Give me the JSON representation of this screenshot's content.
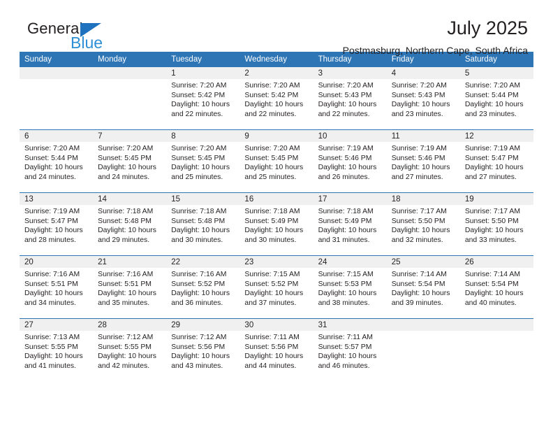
{
  "brand": {
    "name_dark": "General",
    "name_blue": "Blue",
    "accent_blue": "#2e75b6",
    "logo_blue": "#2d8fd5"
  },
  "header": {
    "title": "July 2025",
    "subtitle": "Postmasburg, Northern Cape, South Africa"
  },
  "calendar": {
    "weekday_headers": [
      "Sunday",
      "Monday",
      "Tuesday",
      "Wednesday",
      "Thursday",
      "Friday",
      "Saturday"
    ],
    "weeks": [
      [
        {
          "day": "",
          "sunrise": "",
          "sunset": "",
          "daylight": ""
        },
        {
          "day": "",
          "sunrise": "",
          "sunset": "",
          "daylight": ""
        },
        {
          "day": "1",
          "sunrise": "Sunrise: 7:20 AM",
          "sunset": "Sunset: 5:42 PM",
          "daylight": "Daylight: 10 hours and 22 minutes."
        },
        {
          "day": "2",
          "sunrise": "Sunrise: 7:20 AM",
          "sunset": "Sunset: 5:42 PM",
          "daylight": "Daylight: 10 hours and 22 minutes."
        },
        {
          "day": "3",
          "sunrise": "Sunrise: 7:20 AM",
          "sunset": "Sunset: 5:43 PM",
          "daylight": "Daylight: 10 hours and 22 minutes."
        },
        {
          "day": "4",
          "sunrise": "Sunrise: 7:20 AM",
          "sunset": "Sunset: 5:43 PM",
          "daylight": "Daylight: 10 hours and 23 minutes."
        },
        {
          "day": "5",
          "sunrise": "Sunrise: 7:20 AM",
          "sunset": "Sunset: 5:44 PM",
          "daylight": "Daylight: 10 hours and 23 minutes."
        }
      ],
      [
        {
          "day": "6",
          "sunrise": "Sunrise: 7:20 AM",
          "sunset": "Sunset: 5:44 PM",
          "daylight": "Daylight: 10 hours and 24 minutes."
        },
        {
          "day": "7",
          "sunrise": "Sunrise: 7:20 AM",
          "sunset": "Sunset: 5:45 PM",
          "daylight": "Daylight: 10 hours and 24 minutes."
        },
        {
          "day": "8",
          "sunrise": "Sunrise: 7:20 AM",
          "sunset": "Sunset: 5:45 PM",
          "daylight": "Daylight: 10 hours and 25 minutes."
        },
        {
          "day": "9",
          "sunrise": "Sunrise: 7:20 AM",
          "sunset": "Sunset: 5:45 PM",
          "daylight": "Daylight: 10 hours and 25 minutes."
        },
        {
          "day": "10",
          "sunrise": "Sunrise: 7:19 AM",
          "sunset": "Sunset: 5:46 PM",
          "daylight": "Daylight: 10 hours and 26 minutes."
        },
        {
          "day": "11",
          "sunrise": "Sunrise: 7:19 AM",
          "sunset": "Sunset: 5:46 PM",
          "daylight": "Daylight: 10 hours and 27 minutes."
        },
        {
          "day": "12",
          "sunrise": "Sunrise: 7:19 AM",
          "sunset": "Sunset: 5:47 PM",
          "daylight": "Daylight: 10 hours and 27 minutes."
        }
      ],
      [
        {
          "day": "13",
          "sunrise": "Sunrise: 7:19 AM",
          "sunset": "Sunset: 5:47 PM",
          "daylight": "Daylight: 10 hours and 28 minutes."
        },
        {
          "day": "14",
          "sunrise": "Sunrise: 7:18 AM",
          "sunset": "Sunset: 5:48 PM",
          "daylight": "Daylight: 10 hours and 29 minutes."
        },
        {
          "day": "15",
          "sunrise": "Sunrise: 7:18 AM",
          "sunset": "Sunset: 5:48 PM",
          "daylight": "Daylight: 10 hours and 30 minutes."
        },
        {
          "day": "16",
          "sunrise": "Sunrise: 7:18 AM",
          "sunset": "Sunset: 5:49 PM",
          "daylight": "Daylight: 10 hours and 30 minutes."
        },
        {
          "day": "17",
          "sunrise": "Sunrise: 7:18 AM",
          "sunset": "Sunset: 5:49 PM",
          "daylight": "Daylight: 10 hours and 31 minutes."
        },
        {
          "day": "18",
          "sunrise": "Sunrise: 7:17 AM",
          "sunset": "Sunset: 5:50 PM",
          "daylight": "Daylight: 10 hours and 32 minutes."
        },
        {
          "day": "19",
          "sunrise": "Sunrise: 7:17 AM",
          "sunset": "Sunset: 5:50 PM",
          "daylight": "Daylight: 10 hours and 33 minutes."
        }
      ],
      [
        {
          "day": "20",
          "sunrise": "Sunrise: 7:16 AM",
          "sunset": "Sunset: 5:51 PM",
          "daylight": "Daylight: 10 hours and 34 minutes."
        },
        {
          "day": "21",
          "sunrise": "Sunrise: 7:16 AM",
          "sunset": "Sunset: 5:51 PM",
          "daylight": "Daylight: 10 hours and 35 minutes."
        },
        {
          "day": "22",
          "sunrise": "Sunrise: 7:16 AM",
          "sunset": "Sunset: 5:52 PM",
          "daylight": "Daylight: 10 hours and 36 minutes."
        },
        {
          "day": "23",
          "sunrise": "Sunrise: 7:15 AM",
          "sunset": "Sunset: 5:52 PM",
          "daylight": "Daylight: 10 hours and 37 minutes."
        },
        {
          "day": "24",
          "sunrise": "Sunrise: 7:15 AM",
          "sunset": "Sunset: 5:53 PM",
          "daylight": "Daylight: 10 hours and 38 minutes."
        },
        {
          "day": "25",
          "sunrise": "Sunrise: 7:14 AM",
          "sunset": "Sunset: 5:54 PM",
          "daylight": "Daylight: 10 hours and 39 minutes."
        },
        {
          "day": "26",
          "sunrise": "Sunrise: 7:14 AM",
          "sunset": "Sunset: 5:54 PM",
          "daylight": "Daylight: 10 hours and 40 minutes."
        }
      ],
      [
        {
          "day": "27",
          "sunrise": "Sunrise: 7:13 AM",
          "sunset": "Sunset: 5:55 PM",
          "daylight": "Daylight: 10 hours and 41 minutes."
        },
        {
          "day": "28",
          "sunrise": "Sunrise: 7:12 AM",
          "sunset": "Sunset: 5:55 PM",
          "daylight": "Daylight: 10 hours and 42 minutes."
        },
        {
          "day": "29",
          "sunrise": "Sunrise: 7:12 AM",
          "sunset": "Sunset: 5:56 PM",
          "daylight": "Daylight: 10 hours and 43 minutes."
        },
        {
          "day": "30",
          "sunrise": "Sunrise: 7:11 AM",
          "sunset": "Sunset: 5:56 PM",
          "daylight": "Daylight: 10 hours and 44 minutes."
        },
        {
          "day": "31",
          "sunrise": "Sunrise: 7:11 AM",
          "sunset": "Sunset: 5:57 PM",
          "daylight": "Daylight: 10 hours and 46 minutes."
        },
        {
          "day": "",
          "sunrise": "",
          "sunset": "",
          "daylight": ""
        },
        {
          "day": "",
          "sunrise": "",
          "sunset": "",
          "daylight": ""
        }
      ]
    ]
  }
}
